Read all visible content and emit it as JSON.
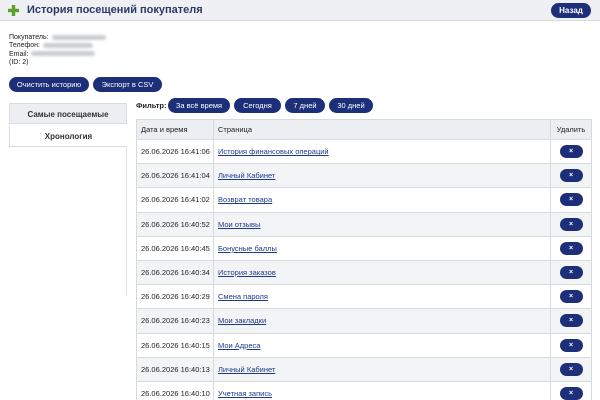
{
  "header": {
    "title": "История посещений покупателя",
    "back_label": "Назад"
  },
  "buyer": {
    "name_label": "Покупатель:",
    "phone_label": "Телефон:",
    "email_label": "Email:",
    "id_text": "(ID: 2)"
  },
  "actions": {
    "clear_label": "Очистить историю",
    "export_label": "Экспорт в CSV"
  },
  "tabs": {
    "most_visited": "Самые посещаемые",
    "chronology": "Хронология"
  },
  "filter": {
    "label": "Фильтр:",
    "all_time": "За всё время",
    "today": "Сегодня",
    "days7": "7 дней",
    "days30": "30 дней"
  },
  "table": {
    "headers": {
      "datetime": "Дата и время",
      "page": "Страница",
      "delete": "Удалить"
    },
    "delete_symbol": "×",
    "rows": [
      {
        "datetime": "26.06.2026 16:41:06",
        "page": "История финансовых операций"
      },
      {
        "datetime": "26.06.2026 16:41:04",
        "page": "Личный Кабинет"
      },
      {
        "datetime": "26.06.2026 16:41:02",
        "page": "Возврат товара"
      },
      {
        "datetime": "26.06.2026 16:40:52",
        "page": "Мои отзывы"
      },
      {
        "datetime": "26.06.2026 16:40:45",
        "page": "Бонусные баллы"
      },
      {
        "datetime": "26.06.2026 16:40:34",
        "page": "История заказов"
      },
      {
        "datetime": "26.06.2026 16:40:29",
        "page": "Смена пароля"
      },
      {
        "datetime": "26.06.2026 16:40:23",
        "page": "Мои закладки"
      },
      {
        "datetime": "26.06.2026 16:40:15",
        "page": "Мои Адреса"
      },
      {
        "datetime": "26.06.2026 16:40:13",
        "page": "Личный Кабинет"
      },
      {
        "datetime": "26.06.2026 16:40:10",
        "page": "Учетная запись"
      }
    ]
  },
  "colors": {
    "button": "#1e2f7a",
    "header_bg": "#eef0f3",
    "title": "#2b3a64",
    "link": "#1e3a8a",
    "plus_icon": "#5aa02c"
  }
}
